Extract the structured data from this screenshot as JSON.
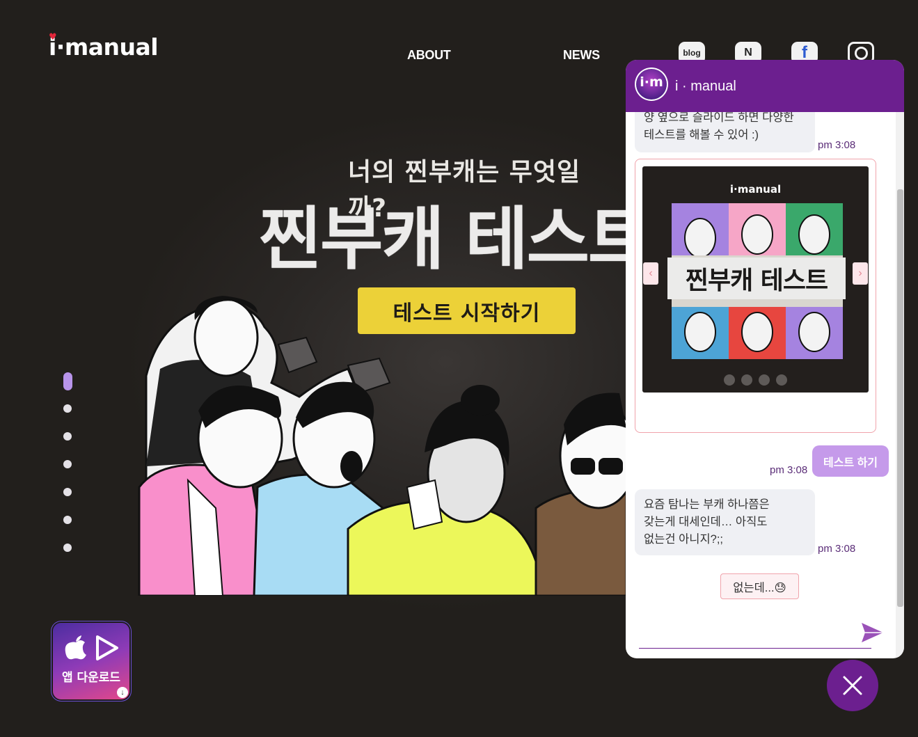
{
  "header": {
    "logo_text": "i·manual",
    "nav": [
      "ABOUT",
      "NEWS"
    ],
    "social": {
      "blog": "blog",
      "naver": "N",
      "facebook": "f"
    }
  },
  "hero": {
    "subtitle": "너의 찐부캐는 무엇일까?",
    "title": "찐부캐 테스트",
    "cta": "테스트 시작하기"
  },
  "pager": {
    "count": 7,
    "active_index": 0
  },
  "app_download": {
    "label": "앱 다운로드"
  },
  "chat": {
    "title": "i · manual",
    "avatar_text": "i·m",
    "messages": [
      {
        "from": "bot",
        "lines": [
          "양 옆으로 슬라이드 하면 다양한",
          "테스트를 해볼 수 있어 :)"
        ],
        "time": "pm 3:08"
      },
      {
        "from": "bot",
        "type": "card",
        "card": {
          "logo": "i·manual",
          "banner": "찐부캐 테스트",
          "dots": 4,
          "active_dot": 0
        }
      },
      {
        "from": "user",
        "text": "테스트 하기",
        "time": "pm 3:08"
      },
      {
        "from": "bot",
        "lines": [
          "요즘 탐나는 부캐 하나쯤은",
          "갖는게 대세인데… 아직도",
          "없는건 아니지?;;"
        ],
        "time": "pm 3:08"
      }
    ],
    "quick_reply": "없는데...😓",
    "input_placeholder": ""
  },
  "colors": {
    "brand_purple": "#6c1f8f",
    "accent_lavender": "#c59aea",
    "cta_yellow": "#ecd138",
    "background": "#221f1c"
  }
}
